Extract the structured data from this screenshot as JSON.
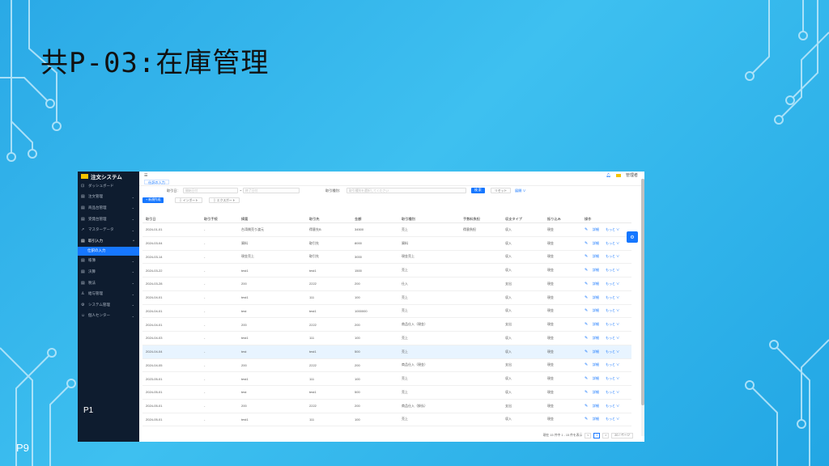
{
  "slide": {
    "title": "共P-03:在庫管理",
    "page_number": "P9"
  },
  "app": {
    "name": "注文システム",
    "user": "管理者",
    "bottom_label": "P1"
  },
  "sidebar": {
    "items": [
      {
        "label": "ダッシュボード",
        "icon": "dashboard-icon",
        "chevron": ""
      },
      {
        "label": "注文管理",
        "icon": "file-icon",
        "chevron": "⌄"
      },
      {
        "label": "商品台管理",
        "icon": "file-icon",
        "chevron": "⌄"
      },
      {
        "label": "受発台管理",
        "icon": "file-icon",
        "chevron": "⌄"
      },
      {
        "label": "マスターデータ",
        "icon": "wrench-icon",
        "chevron": "⌄"
      },
      {
        "label": "取引入力",
        "icon": "file-icon",
        "chevron": "^"
      }
    ],
    "active_sub": "仕訳の入力",
    "items2": [
      {
        "label": "帳簿",
        "icon": "file-icon",
        "chevron": "⌄"
      },
      {
        "label": "決算",
        "icon": "file-icon",
        "chevron": "⌄"
      },
      {
        "label": "税法",
        "icon": "file-icon",
        "chevron": "⌄"
      },
      {
        "label": "給与管理",
        "icon": "user-icon",
        "chevron": "⌄"
      },
      {
        "label": "システム管理",
        "icon": "gear-icon",
        "chevron": "⌄"
      },
      {
        "label": "個人センター",
        "icon": "person-icon",
        "chevron": "⌄"
      }
    ]
  },
  "tabs": [
    "仕訳の入力"
  ],
  "search": {
    "date_label": "取引日:",
    "date_start_placeholder": "開始日付",
    "date_sep": "~",
    "date_end_placeholder": "終了日付",
    "type_label": "取引種別:",
    "type_placeholder": "取引種別を選択してください",
    "search_btn": "検 索",
    "reset_btn": "リセット",
    "expand_link": "展開 ∨"
  },
  "toolbar": {
    "new_btn": "+ 新規作成",
    "import_btn": "インポート",
    "export_btn": "エクスポート"
  },
  "table": {
    "columns": [
      "取引日",
      "取引手続",
      "摘要",
      "取引先",
      "金額",
      "取引種別",
      "手数料負担",
      "収支タイプ",
      "振り込み",
      "操作"
    ],
    "rows": [
      [
        "2024-01-01",
        "-",
        "台湾側売り渡元",
        "得意先B",
        "34500",
        "売上",
        "得意負担",
        "収入",
        "現金"
      ],
      [
        "2024-03-04",
        "-",
        "資料",
        "取引先",
        "8000",
        "資料",
        "",
        "収入",
        "現金"
      ],
      [
        "2024-03-14",
        "-",
        "現金売上",
        "取引先",
        "3000",
        "現金売上",
        "",
        "収入",
        "現金"
      ],
      [
        "2024-03-22",
        "-",
        "test1",
        "test1",
        "1500",
        "売上",
        "",
        "収入",
        "現金"
      ],
      [
        "2024-03-28",
        "-",
        "200",
        "2222",
        "200",
        "仕入",
        "",
        "支出",
        "現金"
      ],
      [
        "2024-04-01",
        "-",
        "test1",
        "111",
        "100",
        "売上",
        "",
        "収入",
        "現金"
      ],
      [
        "2024-04-01",
        "-",
        "test",
        "test1",
        "1000000",
        "売上",
        "",
        "収入",
        "現金"
      ],
      [
        "2024-04-01",
        "-",
        "200",
        "2222",
        "200",
        "商品仕入（現金）",
        "",
        "支出",
        "現金"
      ],
      [
        "2024-04-03",
        "-",
        "test1",
        "111",
        "100",
        "売上",
        "",
        "収入",
        "現金"
      ],
      [
        "2024-04-04",
        "-",
        "test",
        "test1",
        "500",
        "売上",
        "",
        "収入",
        "現金"
      ],
      [
        "2024-04-05",
        "-",
        "200",
        "2222",
        "200",
        "商品仕入（現金）",
        "",
        "支出",
        "現金"
      ],
      [
        "2023-05-01",
        "-",
        "test1",
        "111",
        "100",
        "売上",
        "",
        "収入",
        "現金"
      ],
      [
        "2024-05-01",
        "-",
        "test",
        "test1",
        "500",
        "売上",
        "",
        "収入",
        "現金"
      ],
      [
        "2024-05-01",
        "-",
        "200",
        "2222",
        "200",
        "商品仕入（掛払）",
        "",
        "支出",
        "現金"
      ],
      [
        "2024-05-01",
        "-",
        "test1",
        "111",
        "100",
        "売上",
        "",
        "収入",
        "現金"
      ]
    ],
    "highlight_index": 9,
    "op_labels": {
      "edit": "✎",
      "detail": "詳細",
      "more": "もっと ∨"
    }
  },
  "pager": {
    "summary": "現在 15 件中 1 - 15 件を表示",
    "prev": "<",
    "current": "1",
    "next": ">",
    "size": "20 / ページ"
  },
  "colors": {
    "sidebar_bg": "#0e1c2f",
    "accent": "#1677ff",
    "slide_bg": "#3ec0f0"
  }
}
